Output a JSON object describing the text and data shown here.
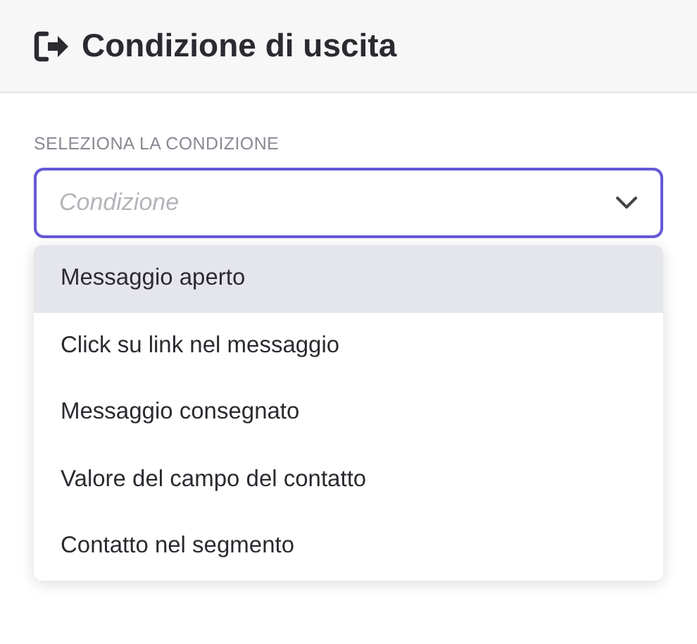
{
  "header": {
    "title": "Condizione di uscita"
  },
  "field": {
    "label": "SELEZIONA LA CONDIZIONE",
    "placeholder": "Condizione",
    "focused": true
  },
  "options": [
    {
      "label": "Messaggio aperto",
      "selected": true
    },
    {
      "label": "Click su link nel messaggio",
      "selected": false
    },
    {
      "label": "Messaggio consegnato",
      "selected": false
    },
    {
      "label": "Valore del campo del contatto",
      "selected": false
    },
    {
      "label": "Contatto nel segmento",
      "selected": false
    }
  ]
}
